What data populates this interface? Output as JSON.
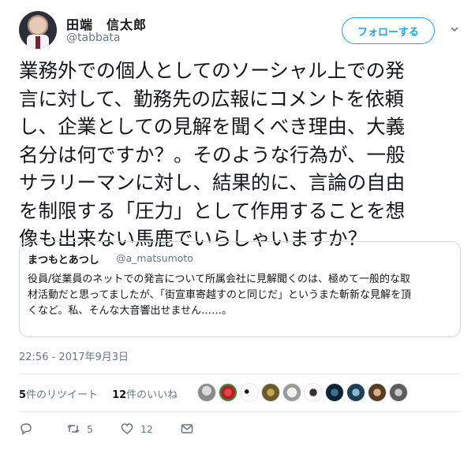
{
  "author": {
    "name": "田端　信太郎",
    "handle": "@tabbata"
  },
  "follow_label": "フォローする",
  "tweet_lines": [
    "業務外での個人としてのソーシャル上での発",
    "言に対して、勤務先の広報にコメントを依頼",
    "し、企業としての見解を聞くべき理由、大義",
    "名分は何ですか？。そのような行為が、一般",
    "サラリーマンに対し、結果的に、言論の自由",
    "を制限する「圧力」として作用することを想",
    "像も出来ない馬鹿でいらしゃいますか？"
  ],
  "quoted": {
    "name": "まつもとあつし",
    "handle": "@a_matsumoto",
    "lines": [
      "役員/従業員のネットでの発言について所属会社に見解聞くのは、極めて一般的な取",
      "材活動だと思ってましたが、「街宣車寄越すのと同じだ」というまた斬新な見解を頂",
      "くなど。私、そんな大音響出せません……。"
    ]
  },
  "timestamp": "22:56 - 2017年9月3日",
  "stats": {
    "retweets_count": "5",
    "retweets_label": "件のリツイート",
    "likes_count": "12",
    "likes_label": "件のいいね"
  },
  "actions": {
    "retweet_count": "5",
    "like_count": "12"
  },
  "icons": [
    "chevron-down-icon",
    "reply-icon",
    "retweet-icon",
    "like-icon",
    "message-icon"
  ],
  "colors": {
    "accent": "#1da1f2",
    "muted": "#657786",
    "border": "#e6ecf0"
  }
}
